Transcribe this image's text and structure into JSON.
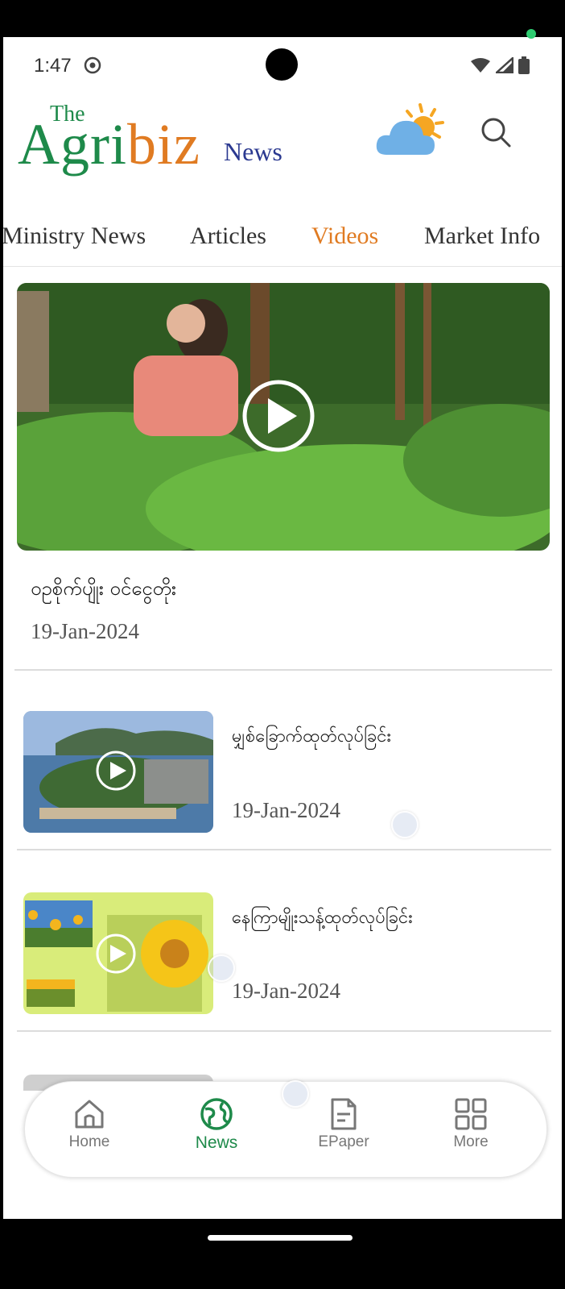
{
  "status_bar": {
    "time": "1:47"
  },
  "header": {
    "logo_the": "The",
    "logo_agri": "Agri",
    "logo_biz": "biz",
    "logo_news": "News"
  },
  "tabs": [
    {
      "label": "Ministry News",
      "active": false
    },
    {
      "label": "Articles",
      "active": false
    },
    {
      "label": "Videos",
      "active": true
    },
    {
      "label": "Market Info",
      "active": false
    }
  ],
  "featured": {
    "title": "ဝဥစိုက်ပျိုး ဝင်ငွေတိုး",
    "date": "19-Jan-2024"
  },
  "videos": [
    {
      "title": "မျှစ်ခြောက်ထုတ်လုပ်ခြင်း",
      "date": "19-Jan-2024"
    },
    {
      "title": "နေကြာမျိုးသန့်ထုတ်လုပ်ခြင်း",
      "date": "19-Jan-2024"
    }
  ],
  "bottom_nav": [
    {
      "label": "Home",
      "icon": "home-icon",
      "active": false
    },
    {
      "label": "News",
      "icon": "globe-icon",
      "active": true
    },
    {
      "label": "EPaper",
      "icon": "document-icon",
      "active": false
    },
    {
      "label": "More",
      "icon": "grid-icon",
      "active": false
    }
  ],
  "colors": {
    "accent_orange": "#e07b22",
    "brand_green": "#1e8a4a",
    "brand_blue": "#2b3990"
  }
}
